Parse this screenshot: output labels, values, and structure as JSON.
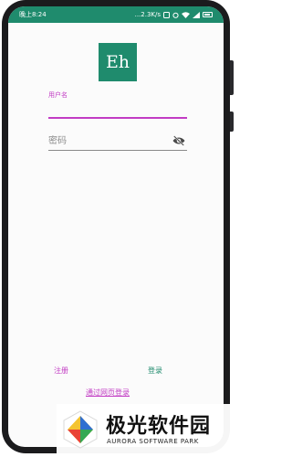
{
  "status_bar": {
    "time": "晚上8:24",
    "speed": "...2.3K/s",
    "background_color": "#1f8b6d"
  },
  "logo": {
    "text": "Eh",
    "color": "#1f8b6d"
  },
  "form": {
    "username_label": "用户名",
    "username_value": "",
    "password_placeholder": "密码",
    "password_value": ""
  },
  "actions": {
    "register_label": "注册",
    "login_label": "登录",
    "web_login_label": "通过网页登录",
    "accent_pink": "#c23cc4",
    "accent_green": "#1f8b6d"
  },
  "watermark": {
    "title": "极光软件园",
    "subtitle": "AURORA SOFTWARE PARK"
  },
  "icons": {
    "password_toggle": "visibility-off-icon",
    "wifi": "wifi-icon",
    "battery": "battery-icon",
    "signal": "signal-icon"
  },
  "battery_level": 0.8
}
